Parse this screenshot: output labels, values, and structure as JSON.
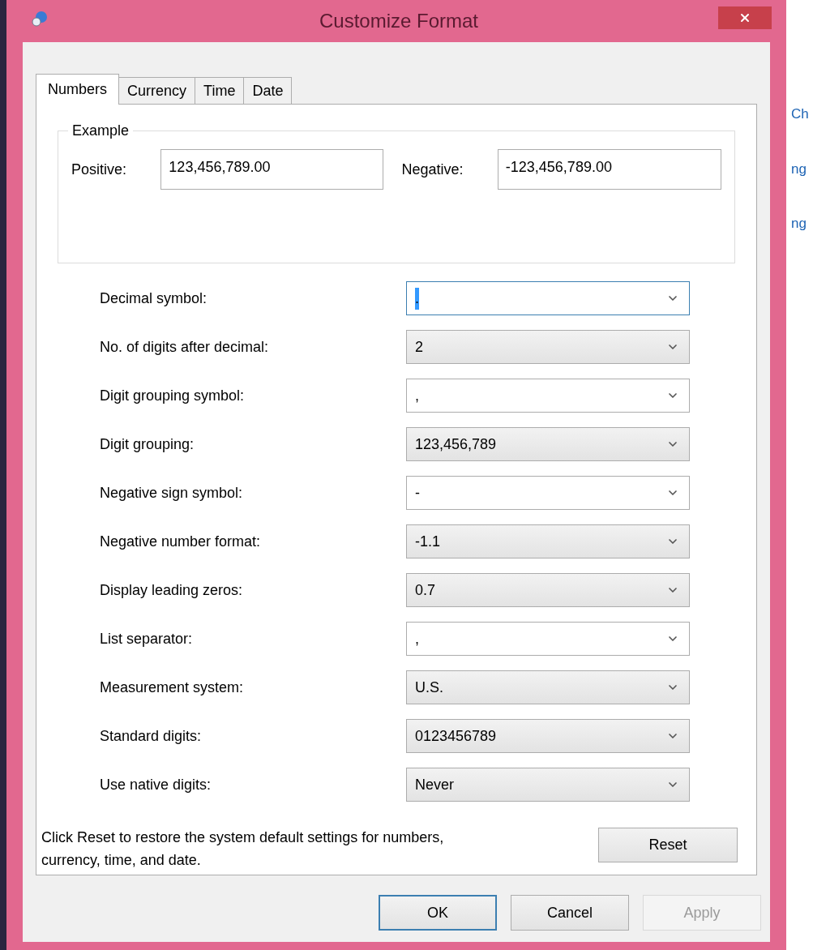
{
  "window": {
    "title": "Customize Format"
  },
  "tabs": [
    {
      "label": "Numbers",
      "selected": true
    },
    {
      "label": "Currency",
      "selected": false
    },
    {
      "label": "Time",
      "selected": false
    },
    {
      "label": "Date",
      "selected": false
    }
  ],
  "example": {
    "title": "Example",
    "positive_label": "Positive:",
    "positive_value": "123,456,789.00",
    "negative_label": "Negative:",
    "negative_value": "-123,456,789.00"
  },
  "settings": [
    {
      "label": "Decimal symbol:",
      "value": ".",
      "kind": "editable",
      "focused": true
    },
    {
      "label": "No. of digits after decimal:",
      "value": "2",
      "kind": "list",
      "focused": false
    },
    {
      "label": "Digit grouping symbol:",
      "value": ",",
      "kind": "editable",
      "focused": false
    },
    {
      "label": "Digit grouping:",
      "value": "123,456,789",
      "kind": "list",
      "focused": false
    },
    {
      "label": "Negative sign symbol:",
      "value": "-",
      "kind": "editable",
      "focused": false
    },
    {
      "label": "Negative number format:",
      "value": "-1.1",
      "kind": "list",
      "focused": false
    },
    {
      "label": "Display leading zeros:",
      "value": "0.7",
      "kind": "list",
      "focused": false
    },
    {
      "label": "List separator:",
      "value": ",",
      "kind": "editable",
      "focused": false
    },
    {
      "label": "Measurement system:",
      "value": "U.S.",
      "kind": "list",
      "focused": false
    },
    {
      "label": "Standard digits:",
      "value": "0123456789",
      "kind": "list",
      "focused": false
    },
    {
      "label": "Use native digits:",
      "value": "Never",
      "kind": "list",
      "focused": false
    }
  ],
  "reset_note": "Click Reset to restore the system default settings for numbers, currency, time, and date.",
  "reset_button": "Reset",
  "buttons": [
    {
      "label": "OK",
      "default": true,
      "disabled": false
    },
    {
      "label": "Cancel",
      "default": false,
      "disabled": false
    },
    {
      "label": "Apply",
      "default": false,
      "disabled": true
    }
  ],
  "background_window": {
    "links": [
      "Ch",
      "ng",
      "ng"
    ]
  }
}
